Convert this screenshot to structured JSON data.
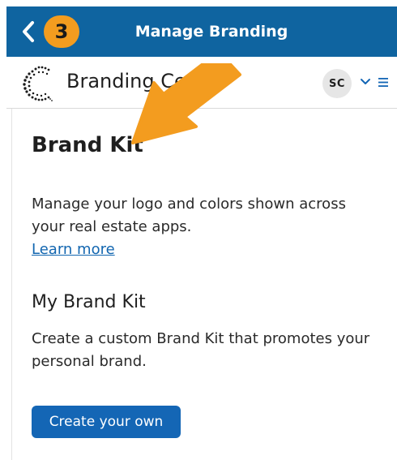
{
  "nav": {
    "title": "Manage Branding",
    "step_badge": "3"
  },
  "header": {
    "app_name": "Branding Center",
    "avatar_initials": "SC"
  },
  "content": {
    "heading": "Brand Kit",
    "description": "Manage your logo and colors shown across your real estate apps.",
    "learn_more": "Learn more",
    "section_heading": "My Brand Kit",
    "section_description": "Create a custom Brand Kit that promotes your personal brand.",
    "create_button": "Create your own"
  },
  "colors": {
    "nav_bg": "#0f64a0",
    "badge": "#f39c1f",
    "arrow": "#f39c1f",
    "primary_button": "#1466b5",
    "link": "#1266b0"
  },
  "icons": {
    "back": "chevron-left-icon",
    "chevron": "chevron-down-icon",
    "menu": "hamburger-menu-icon",
    "logo": "logo-icon",
    "annotation": "arrow-annotation"
  }
}
